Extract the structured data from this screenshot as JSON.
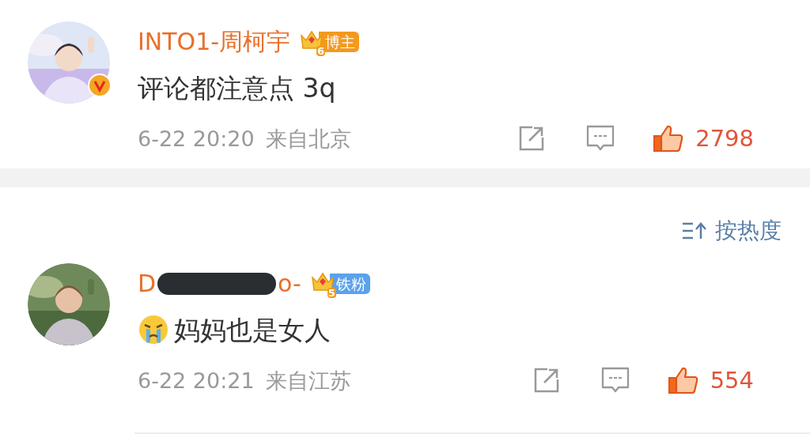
{
  "comments": [
    {
      "author": {
        "name_parts": [
          "INTO1-周柯宇"
        ],
        "redacted": false,
        "verified": true
      },
      "badge": {
        "level": "6",
        "label": "博主",
        "color": "#f39a1e"
      },
      "content": {
        "text": "评论都注意点 3q",
        "leading_emoji": false
      },
      "time": "6-22 20:20",
      "location": "来自北京",
      "likes": "2798",
      "liked": true
    },
    {
      "author": {
        "name_parts": [
          "D",
          "o-"
        ],
        "redacted": true,
        "verified": false
      },
      "badge": {
        "level": "5",
        "label": "铁粉",
        "color": "#5aa2ec"
      },
      "content": {
        "text": "妈妈也是女人",
        "leading_emoji": true
      },
      "time": "6-22 20:21",
      "location": "来自江苏",
      "likes": "554",
      "liked": true
    }
  ],
  "sort": {
    "label": "按热度"
  }
}
